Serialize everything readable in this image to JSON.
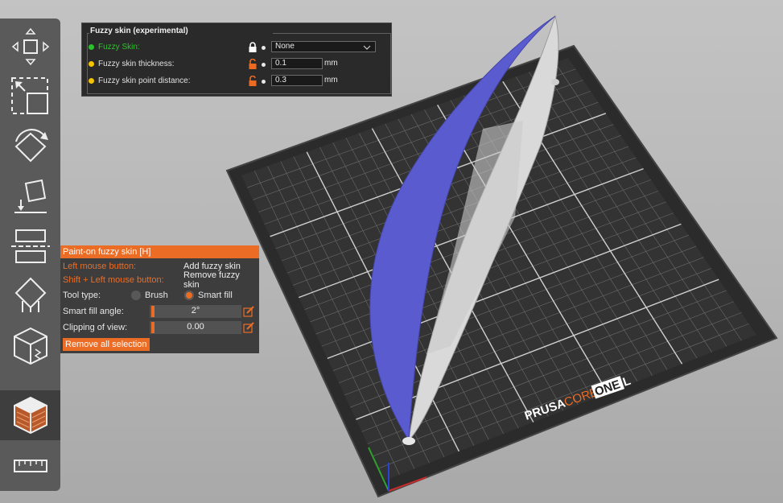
{
  "settings_panel": {
    "title": "Fuzzy skin (experimental)",
    "rows": [
      {
        "label": "Fuzzy Skin:",
        "value": "None",
        "unit": "",
        "bullet_color": "#2cc12c",
        "lock": "locked-icon"
      },
      {
        "label": "Fuzzy skin thickness:",
        "value": "0.1",
        "unit": "mm",
        "bullet_color": "#f5c400",
        "lock": "unlocked-icon"
      },
      {
        "label": "Fuzzy skin point distance:",
        "value": "0.3",
        "unit": "mm",
        "bullet_color": "#f5c400",
        "lock": "unlocked-icon"
      }
    ]
  },
  "paint_panel": {
    "title": "Paint-on fuzzy skin [H]",
    "left_mouse_label": "Left mouse button:",
    "left_mouse_action": "Add fuzzy skin",
    "shift_mouse_label": "Shift + Left mouse button:",
    "shift_mouse_action": "Remove fuzzy skin",
    "tool_type_label": "Tool type:",
    "tool_brush": "Brush",
    "tool_smart_fill": "Smart fill",
    "selected_tool": "Smart fill",
    "smart_fill_angle_label": "Smart fill angle:",
    "smart_fill_angle_value": "2°",
    "clipping_label": "Clipping of view:",
    "clipping_value": "0.00",
    "remove_all_label": "Remove all selection"
  },
  "toolbar": {
    "items": [
      "move-icon",
      "scale-icon",
      "rotate-icon",
      "place-on-face-icon",
      "cut-icon",
      "supports-paint-icon",
      "seam-paint-icon",
      "fuzzy-skin-paint-icon",
      "measure-icon"
    ],
    "active": "fuzzy-skin-paint-icon"
  },
  "bed": {
    "logo_prusa": "PRUSA",
    "logo_core": "CORE",
    "logo_one": "ONE",
    "logo_l": "L"
  },
  "colors": {
    "accent": "#ed6b21",
    "model_painted": "#5a5bcf",
    "model_base": "#d8d8d8",
    "bed": "#2c2c2c"
  }
}
